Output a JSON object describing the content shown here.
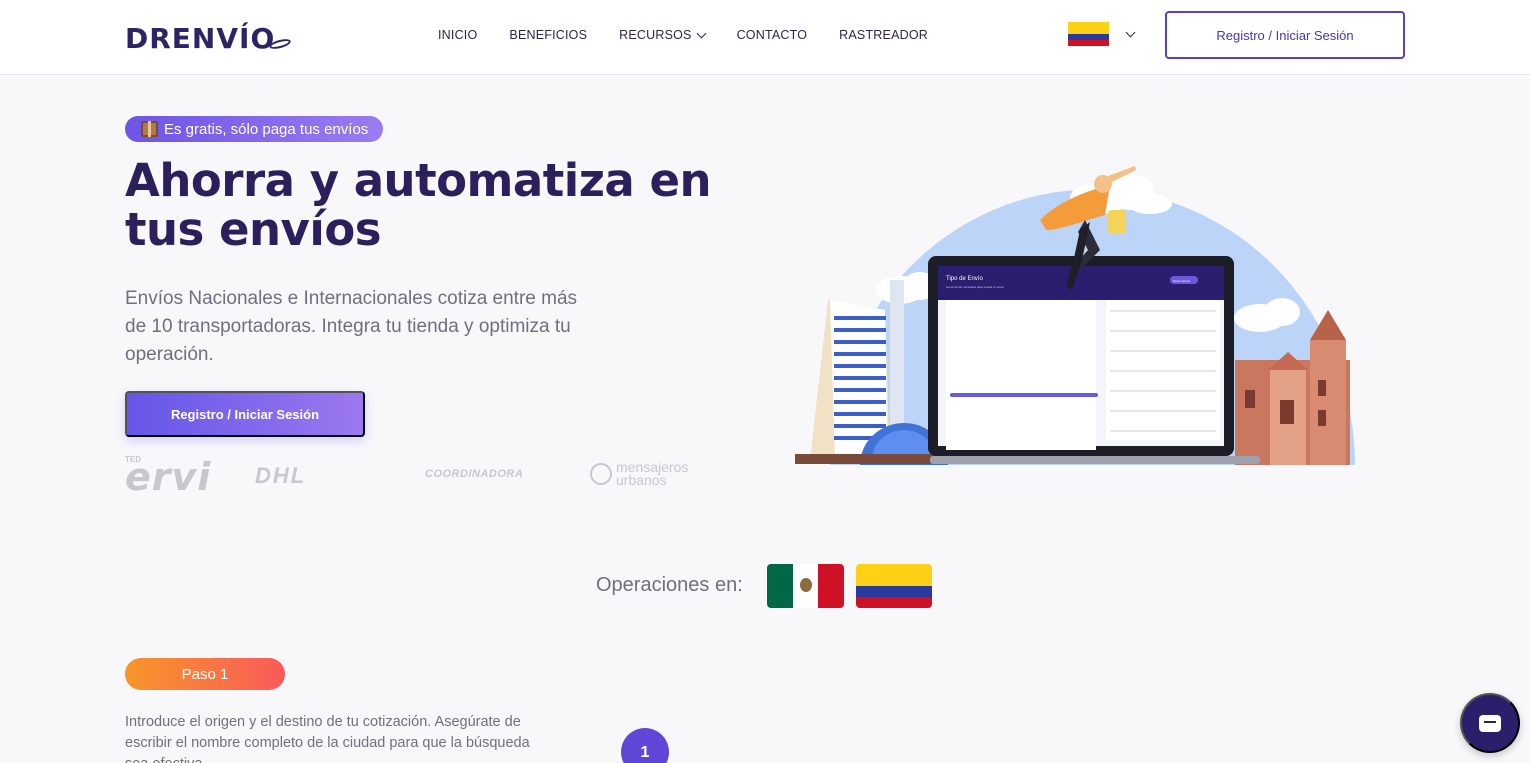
{
  "header": {
    "logo_text": "DRENVÍO",
    "nav": [
      {
        "label": "INICIO"
      },
      {
        "label": "BENEFICIOS"
      },
      {
        "label": "RECURSOS"
      },
      {
        "label": "CONTACTO"
      },
      {
        "label": "RASTREADOR"
      }
    ],
    "language_flag": "colombia-flag",
    "login_label": "Registro / Iniciar Sesión"
  },
  "hero": {
    "badge_text": "Es gratis, sólo paga tus envíos",
    "title": "Ahorra y automatiza en tus envíos",
    "subtitle": "Envíos Nacionales e Internacionales cotiza entre más de 10 transportadoras. Integra tu tienda y optimiza tu operación.",
    "cta_label": "Registro / Iniciar Sesión"
  },
  "carriers": [
    {
      "name": "servi",
      "text": "ervi",
      "small_text": "TED"
    },
    {
      "name": "dhl",
      "text": "DHL"
    },
    {
      "name": "coordinadora",
      "text": "COORDINADORA"
    },
    {
      "name": "mensajeros-urbanos",
      "text_line1": "mensajeros",
      "text_line2": "urbanos"
    }
  ],
  "illustration": {
    "screen_title": "Tipo de Envío",
    "screen_subtitle": "Llena la info necesaria para cotizar tu envío",
    "screen_button": "Nuevo Envío"
  },
  "operations": {
    "label": "Operaciones en:",
    "countries": [
      "mexico-flag",
      "colombia-flag"
    ]
  },
  "step": {
    "badge": "Paso 1",
    "text": "Introduce el origen y el destino de tu cotización. Asegúrate de escribir el nombre completo de la ciudad para que la búsqueda sea efectiva.",
    "number": "1"
  },
  "colors": {
    "primary": "#5f46d6",
    "navy": "#2b1f5c",
    "orange": "#f7962a",
    "background": "#f8f8fb"
  }
}
